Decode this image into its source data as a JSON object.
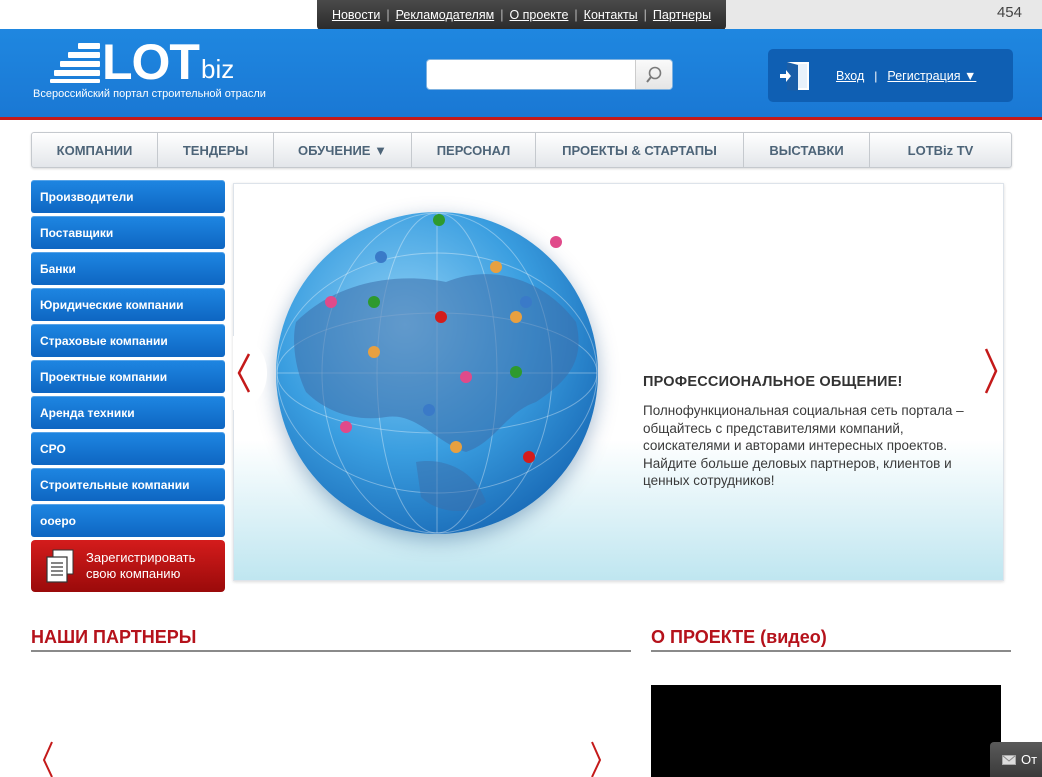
{
  "top_nav": {
    "links": [
      "Новости",
      "Рекламодателям",
      "О проекте",
      "Контакты",
      "Партнеры"
    ],
    "counter": "454"
  },
  "header": {
    "logo_main": "LOT",
    "logo_suffix": "biz",
    "tagline": "Всероссийский портал строительной отрасли",
    "search_placeholder": "",
    "login_label": "Вход",
    "register_label": "Регистрация ▼"
  },
  "main_nav": {
    "items": [
      "КОМПАНИИ",
      "ТЕНДЕРЫ",
      "ОБУЧЕНИЕ ▼",
      "ПЕРСОНАЛ",
      "ПРОЕКТЫ & СТАРТАПЫ",
      "ВЫСТАВКИ",
      "LOTBiz TV"
    ]
  },
  "sidebar": {
    "items": [
      "Производители",
      "Поставщики",
      "Банки",
      "Юридические компании",
      "Страховые компании",
      "Проектные компании",
      "Аренда техники",
      "СРО",
      "Строительные компании",
      "ооеро"
    ],
    "register_line1": "Зарегистрировать",
    "register_line2": "свою компанию"
  },
  "slider": {
    "title": "ПРОФЕССИОНАЛЬНОЕ ОБЩЕНИЕ!",
    "text": "Полнофункциональная социальная сеть портала – общайтесь с представителями компаний, соискателями и авторами интересных проектов. Найдите больше деловых партнеров, клиентов и ценных сотрудников!"
  },
  "sections": {
    "partners_title": "НАШИ ПАРТНЕРЫ",
    "video_title": "О ПРОЕКТЕ (видео)"
  },
  "feedback": {
    "label": "От"
  },
  "colors": {
    "header_blue": "#1a78d4",
    "accent_red": "#b5121b",
    "sidebar_blue": "#0e66c2",
    "register_red": "#c41a1a"
  }
}
